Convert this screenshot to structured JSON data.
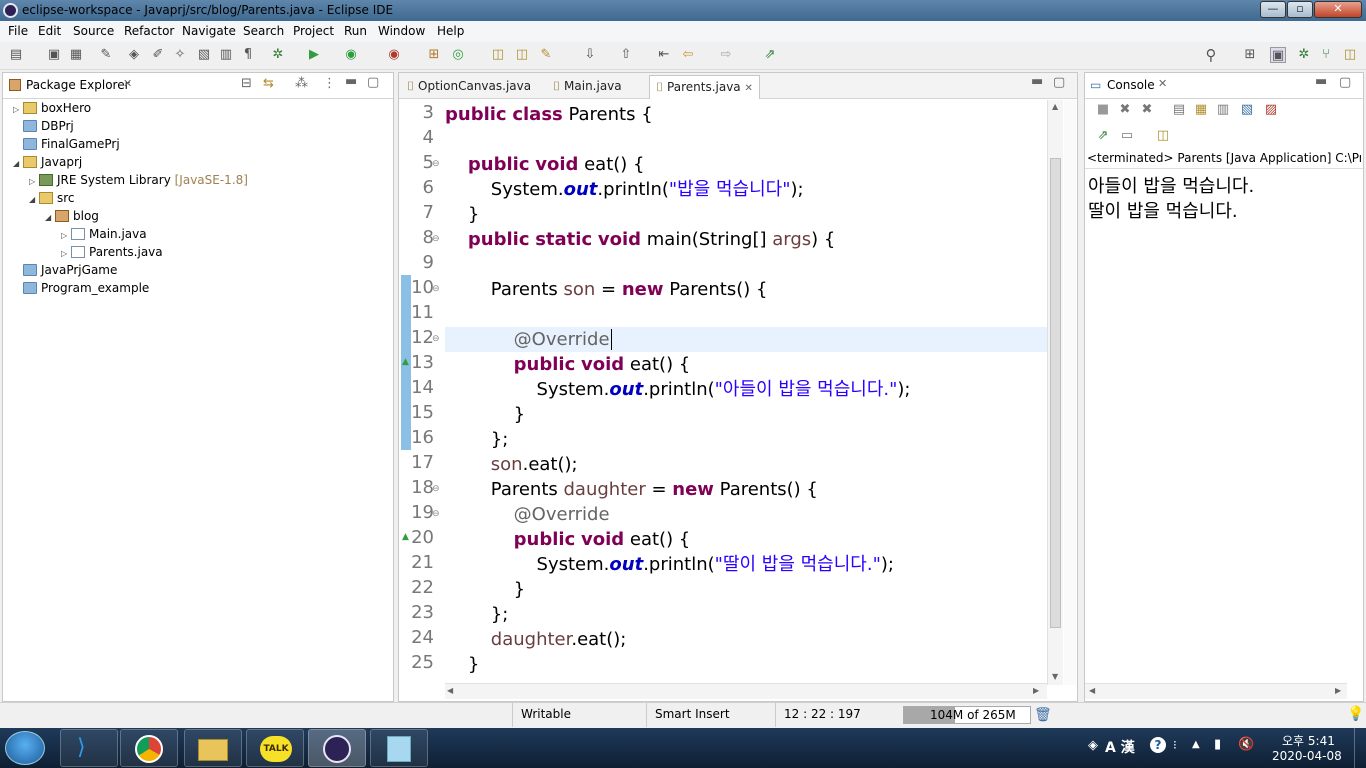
{
  "window": {
    "title": "eclipse-workspace - Javaprj/src/blog/Parents.java - Eclipse IDE",
    "minimize": "—",
    "maximize": "▫",
    "close": "✕"
  },
  "menu": [
    "File",
    "Edit",
    "Source",
    "Refactor",
    "Navigate",
    "Search",
    "Project",
    "Run",
    "Window",
    "Help"
  ],
  "package_explorer": {
    "title": "Package Explorer",
    "tree": [
      {
        "label": "boxHero",
        "icon": "project-icon"
      },
      {
        "label": "DBPrj",
        "icon": "folder-icon"
      },
      {
        "label": "FinalGamePrj",
        "icon": "folder-icon"
      },
      {
        "label": "Javaprj",
        "icon": "project-icon"
      },
      {
        "label": "JRE System Library",
        "suffix": "[JavaSE-1.8]",
        "icon": "library-icon"
      },
      {
        "label": "src",
        "icon": "source-folder-icon"
      },
      {
        "label": "blog",
        "icon": "package-icon"
      },
      {
        "label": "Main.java",
        "icon": "java-file-icon"
      },
      {
        "label": "Parents.java",
        "icon": "java-file-icon"
      },
      {
        "label": "JavaPrjGame",
        "icon": "folder-icon"
      },
      {
        "label": "Program_example",
        "icon": "folder-icon"
      }
    ]
  },
  "editor": {
    "tabs": [
      {
        "label": "OptionCanvas.java",
        "active": false
      },
      {
        "label": "Main.java",
        "active": false
      },
      {
        "label": "Parents.java",
        "active": true
      }
    ],
    "line_numbers": [
      "3",
      "4",
      "5",
      "6",
      "7",
      "8",
      "9",
      "10",
      "11",
      "12",
      "13",
      "14",
      "15",
      "16",
      "17",
      "18",
      "19",
      "20",
      "21",
      "22",
      "23",
      "24",
      "25"
    ]
  },
  "console": {
    "title": "Console",
    "status": "<terminated> Parents [Java Application] C:\\Progra",
    "output": [
      "아들이 밥을 먹습니다.",
      "딸이 밥을 먹습니다."
    ]
  },
  "statusbar": {
    "writable": "Writable",
    "insert_mode": "Smart Insert",
    "position": "12 : 22 : 197",
    "heap": "104M of 265M"
  },
  "taskbar": {
    "time": "오후 5:41",
    "date": "2020-04-08",
    "ime": "A 漢"
  },
  "colors": {
    "keyword": "#7f0055",
    "string": "#2a00ff",
    "field": "#0000c0",
    "annotation": "#646464"
  }
}
